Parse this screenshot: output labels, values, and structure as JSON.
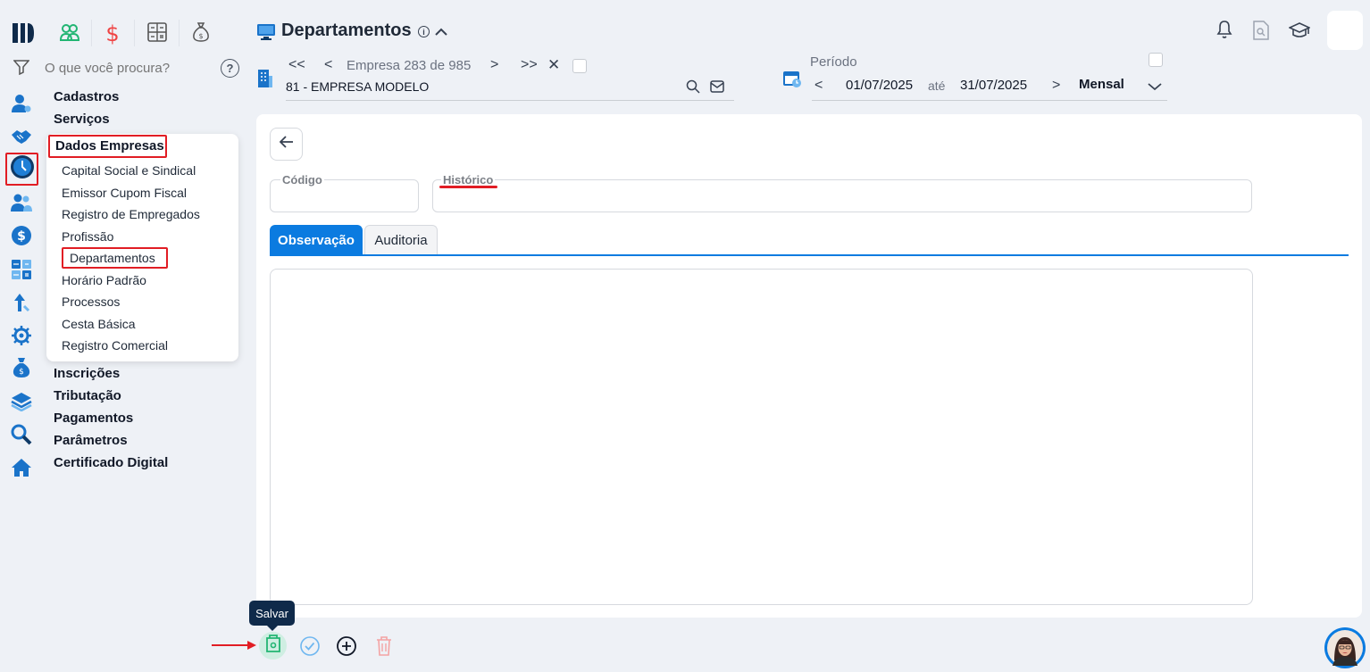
{
  "app": {
    "logo_text": ""
  },
  "header": {
    "title": "Departamentos",
    "info_icon": "info-circle-icon",
    "collapse_icon": "chevron-up-icon"
  },
  "search": {
    "placeholder": "O que você procura?"
  },
  "company": {
    "counter_label": "Empresa",
    "current": "283",
    "of_label": "de",
    "total": "985",
    "name": "81 - EMPRESA MODELO"
  },
  "period": {
    "label": "Período",
    "start": "01/07/2025",
    "until_label": "até",
    "end": "31/07/2025",
    "mode": "Mensal"
  },
  "menu": {
    "sections_top": [
      "Cadastros",
      "Serviços",
      "Dados Empresas"
    ],
    "submenu": [
      "Capital Social e Sindical",
      "Emissor Cupom Fiscal",
      "Registro de Empregados",
      "Profissão",
      "Departamentos",
      "Horário Padrão",
      "Processos",
      "Cesta Básica",
      "Registro Comercial"
    ],
    "sections_bottom": [
      "Inscrições",
      "Tributação",
      "Pagamentos",
      "Parâmetros",
      "Certificado Digital"
    ]
  },
  "form": {
    "codigo_label": "Código",
    "codigo_value": "",
    "historico_label": "Histórico",
    "historico_value": "",
    "tabs": [
      "Observação",
      "Auditoria"
    ],
    "observacao_value": ""
  },
  "toolbar": {
    "save_tooltip": "Salvar"
  },
  "colors": {
    "accent": "#0b7be0",
    "highlight_red": "#e11d24",
    "save_green": "#22b573",
    "tooltip_bg": "#0f2a4a"
  }
}
